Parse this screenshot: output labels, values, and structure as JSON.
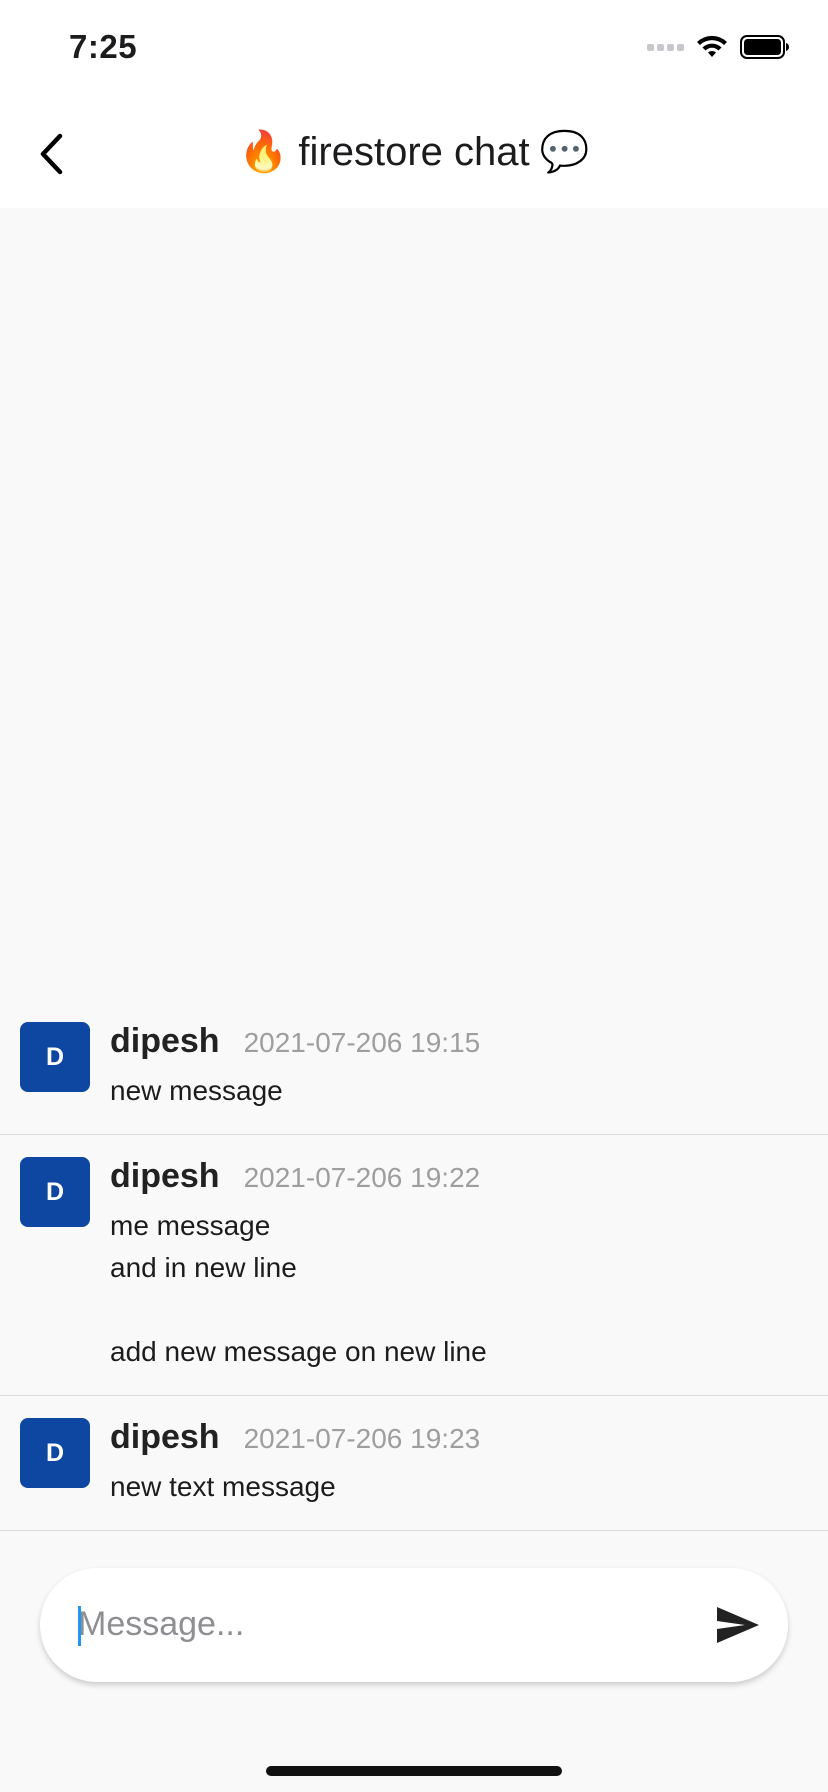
{
  "status_bar": {
    "time": "7:25"
  },
  "header": {
    "title_text": "firestore chat",
    "title_left_emoji": "🔥",
    "title_right_emoji": "💬"
  },
  "messages": [
    {
      "avatar_letter": "D",
      "author": "dipesh",
      "time": "2021-07-206 19:15",
      "text": "new message"
    },
    {
      "avatar_letter": "D",
      "author": "dipesh",
      "time": "2021-07-206 19:22",
      "text": "me message\nand in new line\n\nadd new message on new line"
    },
    {
      "avatar_letter": "D",
      "author": "dipesh",
      "time": "2021-07-206 19:23",
      "text": "new text message"
    }
  ],
  "composer": {
    "placeholder": "Message...",
    "value": ""
  },
  "colors": {
    "avatar_background": "#0d47a1",
    "caret": "#2196f3",
    "background": "#f9f9f9"
  }
}
